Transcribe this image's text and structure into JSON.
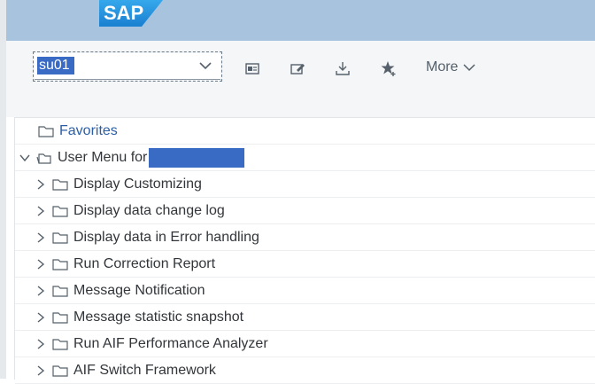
{
  "app": {
    "logo_text": "SAP"
  },
  "toolbar": {
    "command_field_value": "su01",
    "more_label": "More"
  },
  "tree": {
    "favorites_label": "Favorites",
    "user_menu_label": "User Menu for",
    "items": [
      {
        "label": "Display Customizing"
      },
      {
        "label": "Display data change log"
      },
      {
        "label": "Display data in Error handling"
      },
      {
        "label": "Run Correction Report"
      },
      {
        "label": "Message Notification"
      },
      {
        "label": "Message statistic snapshot"
      },
      {
        "label": "Run AIF Performance Analyzer"
      },
      {
        "label": "AIF Switch Framework"
      }
    ]
  },
  "colors": {
    "header": "#a8c3dd",
    "sap_blue": "#1a8fd8",
    "selection": "#3a6bc4"
  }
}
